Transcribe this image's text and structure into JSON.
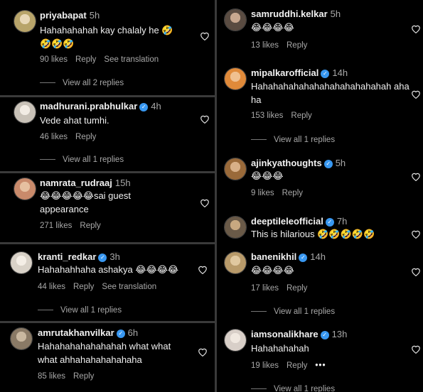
{
  "common": {
    "reply": "Reply",
    "see_translation": "See translation"
  },
  "left": [
    {
      "username": "priyabapat",
      "verified": false,
      "time": "5h",
      "text": "Hahahahahah kay chalaly he 🤣🤣🤣🤣",
      "likes": "90 likes",
      "translation": true,
      "view_replies": "View all 2 replies",
      "avatar_color": "#b8a46a"
    },
    {
      "username": "madhurani.prabhulkar",
      "verified": true,
      "time": "4h",
      "text": "Vede ahat tumhi.",
      "likes": "46 likes",
      "translation": false,
      "view_replies": "View all 1 replies",
      "avatar_color": "#c9c2b8"
    },
    {
      "username": "namrata_rudraaj",
      "verified": false,
      "time": "15h",
      "text": "😂😂😂😂😂sai guest appearance",
      "likes": "271 likes",
      "translation": false,
      "view_replies": "",
      "avatar_color": "#c98a6b"
    },
    {
      "username": "kranti_redkar",
      "verified": true,
      "time": "3h",
      "text": "Hahahahhaha ashakya 😂😂😂😂",
      "likes": "44 likes",
      "translation": true,
      "view_replies": "View all 1 replies",
      "avatar_color": "#d9d2c8"
    },
    {
      "username": "amrutakhanvilkar",
      "verified": true,
      "time": "6h",
      "text": "Hahahahahahahahah what what what ahhahahahahahaha",
      "likes": "85 likes",
      "translation": false,
      "view_replies": "",
      "avatar_color": "#8a7a66"
    }
  ],
  "right": [
    {
      "username": "samruddhi.kelkar",
      "verified": false,
      "time": "5h",
      "text": "😂😂😂😂",
      "likes": "13 likes",
      "view_replies": "",
      "avatar_color": "#5a4c42"
    },
    {
      "username": "mipalkarofficial",
      "verified": true,
      "time": "14h",
      "text": "Hahahahahahahahahahahahahah ahaha",
      "likes": "153 likes",
      "view_replies": "View all 1 replies",
      "avatar_color": "#e08a3a"
    },
    {
      "username": "ajinkyathoughts",
      "verified": true,
      "time": "5h",
      "text": "😂😂😂",
      "likes": "9 likes",
      "view_replies": "",
      "avatar_color": "#9a6a3a"
    },
    {
      "username": "deeptileleofficial",
      "verified": true,
      "time": "7h",
      "text": "This is hilarious 🤣🤣🤣🤣🤣",
      "likes": "",
      "view_replies": "",
      "avatar_color": "#6a5a48"
    },
    {
      "username": "banenikhil",
      "verified": true,
      "time": "14h",
      "text": "😂😂😂😂",
      "likes": "17 likes",
      "view_replies": "View all 1 replies",
      "avatar_color": "#b89a6a"
    },
    {
      "username": "iamsonalikhare",
      "verified": true,
      "time": "13h",
      "text": "Hahahahahah",
      "likes": "19 likes",
      "more": "•••",
      "view_replies": "View all 1 replies",
      "avatar_color": "#d8cfc8"
    }
  ]
}
